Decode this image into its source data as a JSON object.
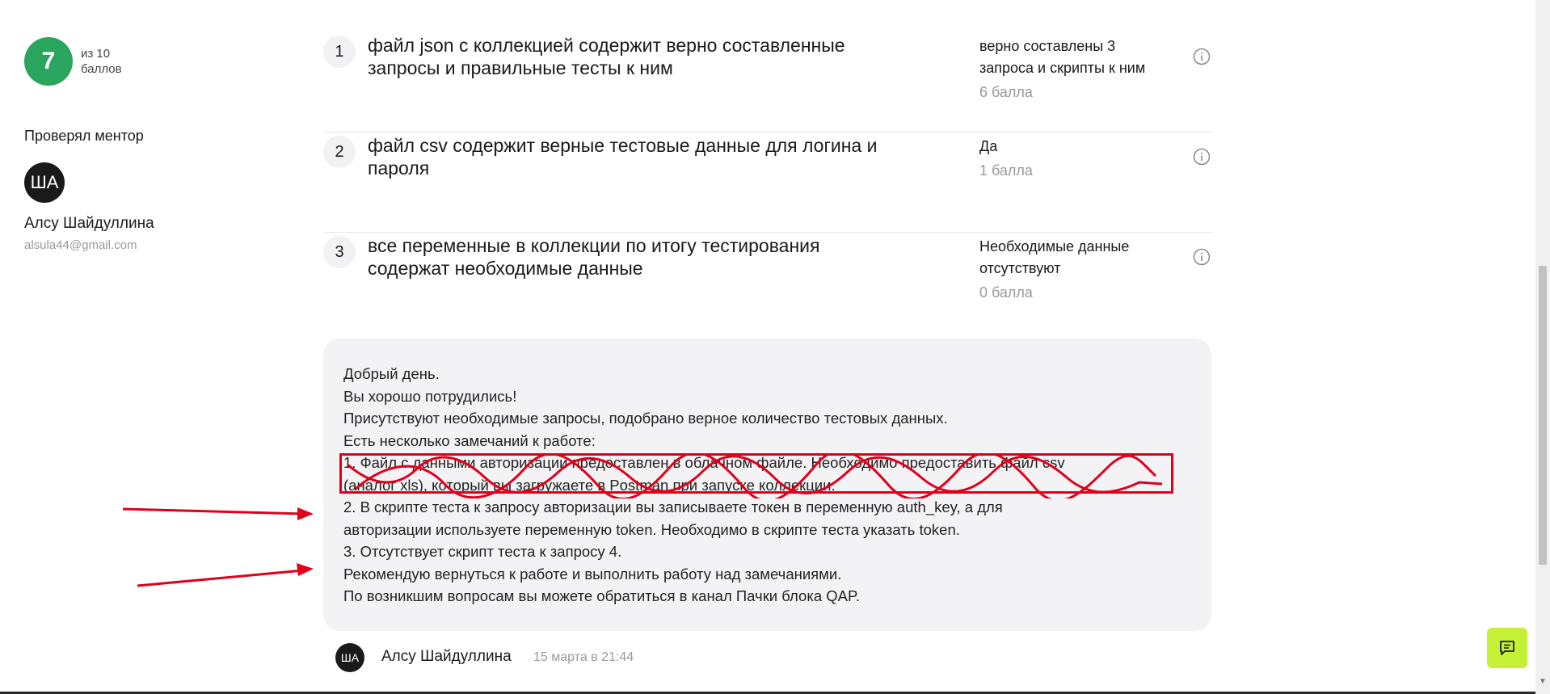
{
  "sidebar": {
    "score_value": "7",
    "score_label_line1": "из 10",
    "score_label_line2": "баллов",
    "mentor_label": "Проверял ментор",
    "mentor_initials": "ША",
    "mentor_name": "Алсу Шайдуллина",
    "mentor_email": "alsula44@gmail.com"
  },
  "criteria": [
    {
      "number": "1",
      "title": "файл json с коллекцией содержит верно составленные запросы и правильные тесты к ним",
      "result": "верно составлены 3 запроса и скрипты к ним",
      "points": "6 балла",
      "icon": "info-icon"
    },
    {
      "number": "2",
      "title": "файл csv содержит верные тестовые данные для логина и пароля",
      "result": "Да",
      "points": "1 балла",
      "icon": "info-icon"
    },
    {
      "number": "3",
      "title": "все переменные в коллекции по итогу тестирования содержат необходимые данные",
      "result": "Необходимые данные отсутствуют",
      "points": "0 балла",
      "icon": "info-icon"
    }
  ],
  "comment": {
    "lines": [
      "Добрый день.",
      "Вы хорошо потрудились!",
      "Присутствуют необходимые запросы, подобрано верное количество тестовых данных.",
      "Есть несколько замечаний к работе:",
      "1. Файл с данными авторизации предоставлен в облачном файле. Необходимо предоставить файл csv",
      "(аналог xls), который вы загружаете в Postman при запуске коллекции.",
      "2. В скрипте теста к запросу авторизации вы записываете токен в переменную auth_key, а для",
      "авторизации используете переменную token. Необходимо в скрипте теста указать token.",
      "3. Отсутствует скрипт теста к запросу 4.",
      "Рекомендую вернуться к работе и выполнить работу над замечаниями.",
      "По возникшим вопросам вы можете обратиться в канал Пачки блока QAP."
    ]
  },
  "footer": {
    "author_initials": "ША",
    "author_name": "Алсу Шайдуллина",
    "date": "15 марта в 21:44"
  },
  "colors": {
    "score_green": "#2aa55e",
    "annotation_red": "#e0001b",
    "chat_button": "#c4f135",
    "comment_bg": "#f3f3f5"
  },
  "chat_button_icon": "chat-icon"
}
